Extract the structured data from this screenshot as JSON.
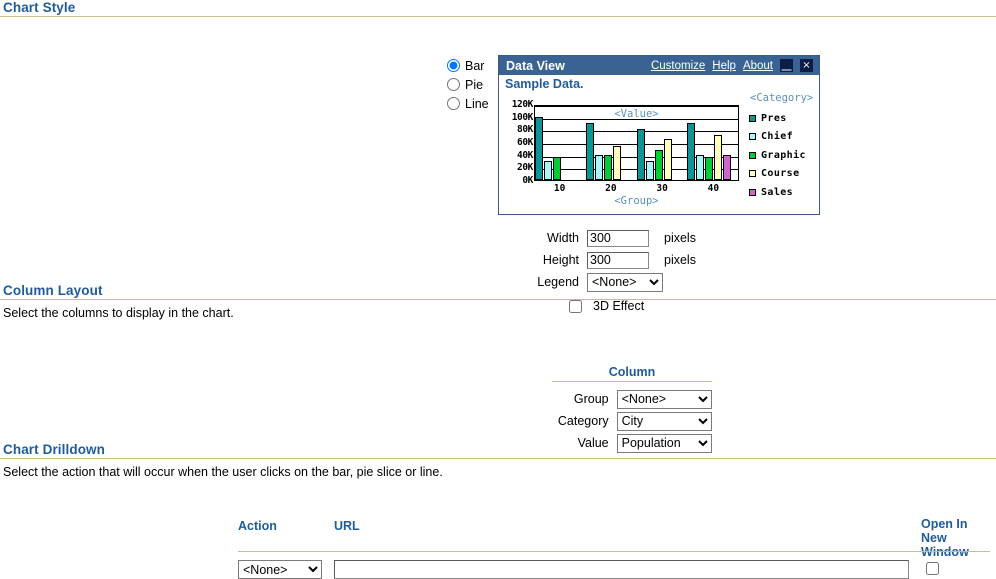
{
  "sections": {
    "chart_style": {
      "title": "Chart Style"
    },
    "column_layout": {
      "title": "Column Layout",
      "description": "Select the columns to display in the chart.",
      "column_header": "Column",
      "rows": [
        {
          "label": "Group",
          "value": "<None>"
        },
        {
          "label": "Category",
          "value": "City"
        },
        {
          "label": "Value",
          "value": "Population"
        }
      ]
    },
    "chart_drilldown": {
      "title": "Chart Drilldown",
      "description": "Select the action that will occur when the user clicks on the bar, pie slice or line.",
      "action_header": "Action",
      "url_header": "URL",
      "newwindow_header": "Open In New Window",
      "action_value": "<None>",
      "url_value": "",
      "url_placeholder": ""
    }
  },
  "chart_style_options": {
    "radios": [
      {
        "label": "Bar",
        "selected": true
      },
      {
        "label": "Pie",
        "selected": false
      },
      {
        "label": "Line",
        "selected": false
      }
    ],
    "width_label": "Width",
    "width_value": "300",
    "width_units": "pixels",
    "height_label": "Height",
    "height_value": "300",
    "height_units": "pixels",
    "legend_label": "Legend",
    "legend_value": "<None>",
    "threed_label": "3D Effect",
    "threed_checked": false
  },
  "data_view": {
    "title": "Data View",
    "links": [
      {
        "label": "Customize"
      },
      {
        "label": "Help"
      },
      {
        "label": "About"
      }
    ],
    "minimize_icon": "⎽",
    "close_icon": "×",
    "subtitle": "Sample Data."
  },
  "chart_data": {
    "type": "bar",
    "title": "",
    "xlabel": "<Group>",
    "ylabel": "<Value>",
    "legend_title": "<Category>",
    "legend_position": "right",
    "grid": true,
    "categories": [
      "10",
      "20",
      "30",
      "40"
    ],
    "ylim": [
      0,
      120000
    ],
    "ytick_labels": [
      "120K",
      "100K",
      "80K",
      "60K",
      "40K",
      "20K",
      "0K"
    ],
    "ytick_values": [
      120000,
      100000,
      80000,
      60000,
      40000,
      20000,
      0
    ],
    "series": [
      {
        "name": "Pres",
        "color": "#0E9494",
        "values": [
          100000,
          90000,
          80000,
          90000
        ]
      },
      {
        "name": "Chief",
        "color": "#A9F5F5",
        "values": [
          30000,
          40000,
          30000,
          40000
        ]
      },
      {
        "name": "Graphic",
        "color": "#00CC33",
        "values": [
          36000,
          40000,
          47000,
          36000
        ]
      },
      {
        "name": "Course",
        "color": "#FFFFBF",
        "values": [
          null,
          54000,
          64000,
          71000
        ]
      },
      {
        "name": "Sales",
        "color": "#CC66CC",
        "values": [
          null,
          null,
          null,
          40000
        ]
      }
    ]
  }
}
